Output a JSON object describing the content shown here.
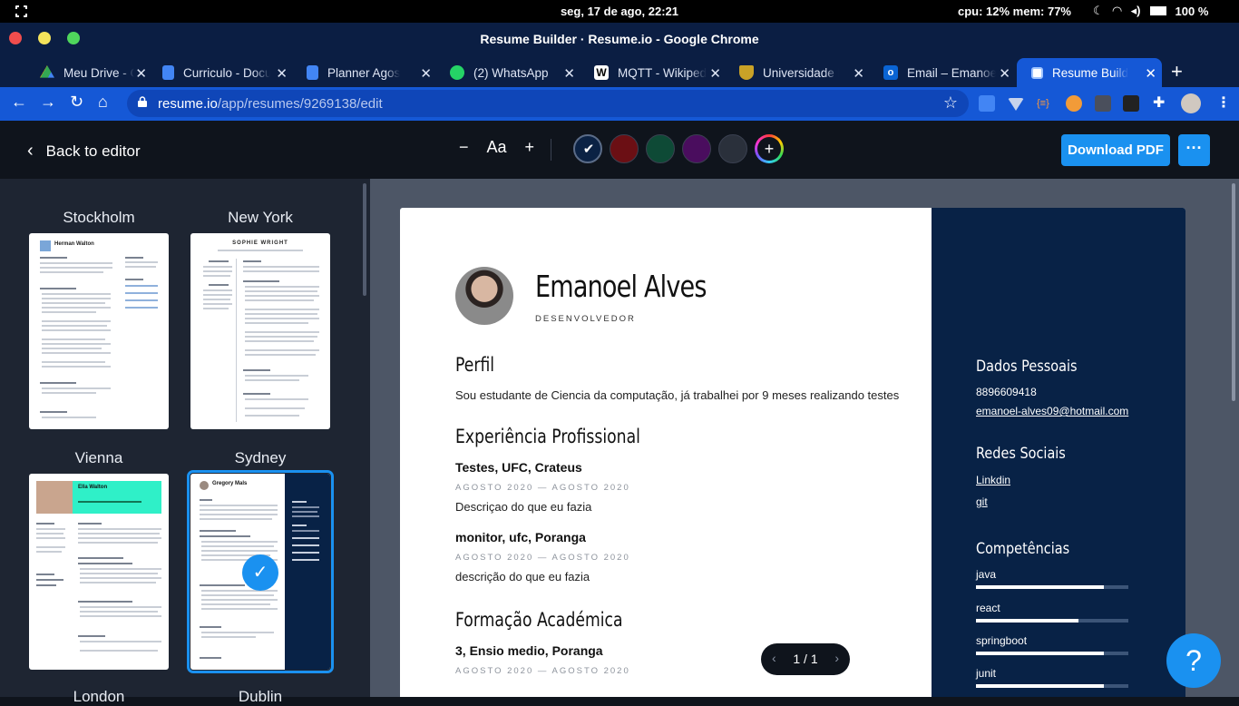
{
  "os": {
    "clock": "seg, 17 de ago, 22:21",
    "stats": "cpu: 12% mem: 77%",
    "battery": "100 %"
  },
  "window": {
    "title": "Resume Builder · Resume.io - Google Chrome"
  },
  "tabs": [
    {
      "label": "Meu Drive - Google Drive",
      "color": "#34a853"
    },
    {
      "label": "Curriculo - Documentos",
      "color": "#4285f4"
    },
    {
      "label": "Planner Agosto",
      "color": "#4285f4"
    },
    {
      "label": "(2) WhatsApp",
      "color": "#25d366"
    },
    {
      "label": "MQTT - Wikipedia",
      "color": "#ffffff"
    },
    {
      "label": "Universidade Federal",
      "color": "#c9a227"
    },
    {
      "label": "Email – Emanoel",
      "color": "#0a64d4"
    },
    {
      "label": "Resume Builder",
      "color": "#ffffff"
    }
  ],
  "address": {
    "host": "resume.io",
    "path": "/app/resumes/9269138/edit"
  },
  "header": {
    "back_label": "Back to editor",
    "font_minus": "−",
    "font_label": "Aa",
    "font_plus": "+",
    "download_label": "Download PDF",
    "more_label": "···"
  },
  "colors": {
    "swatches": [
      "#0b2244",
      "#6b0f14",
      "#0e4a36",
      "#4a0d5e",
      "#2a303b"
    ],
    "accent": "#1a91f0"
  },
  "templates": [
    {
      "name": "Stockholm"
    },
    {
      "name": "New York"
    },
    {
      "name": "Vienna"
    },
    {
      "name": "Sydney"
    },
    {
      "name": "London"
    },
    {
      "name": "Dublin"
    }
  ],
  "thumbs": {
    "stockholm_name": "Herman Walton",
    "newyork_name": "SOPHIE WRIGHT",
    "vienna_name": "Ella Walton",
    "sydney_name": "Gregory Mals"
  },
  "resume": {
    "name": "Emanoel Alves",
    "role": "DESENVOLVEDOR",
    "profile_title": "Perfil",
    "profile_text": "Sou estudante de Ciencia da computação, já trabalhei por 9 meses realizando testes",
    "experience_title": "Experiência Profissional",
    "jobs": [
      {
        "title": "Testes, UFC, Crateus",
        "dates": "AGOSTO 2020 — AGOSTO 2020",
        "desc": "Descriçao do que eu fazia"
      },
      {
        "title": "monitor, ufc, Poranga",
        "dates": "AGOSTO 2020 — AGOSTO 2020",
        "desc": "descrição do que eu fazia"
      }
    ],
    "education_title": "Formação Académica",
    "education": [
      {
        "title": "3, Ensio medio, Poranga",
        "dates": "AGOSTO 2020 — AGOSTO 2020"
      }
    ],
    "personal_title": "Dados Pessoais",
    "phone": "8896609418",
    "email": "emanoel-alves09@hotmail.com",
    "social_title": "Redes Sociais",
    "links": [
      "Linkdin",
      "git"
    ],
    "skills_title": "Competências",
    "skills": [
      {
        "name": "java",
        "level": 0.84
      },
      {
        "name": "react",
        "level": 0.67
      },
      {
        "name": "springboot",
        "level": 0.84
      },
      {
        "name": "junit",
        "level": 0.84
      }
    ]
  },
  "pager": {
    "label": "1 / 1"
  },
  "help": {
    "label": "?"
  }
}
